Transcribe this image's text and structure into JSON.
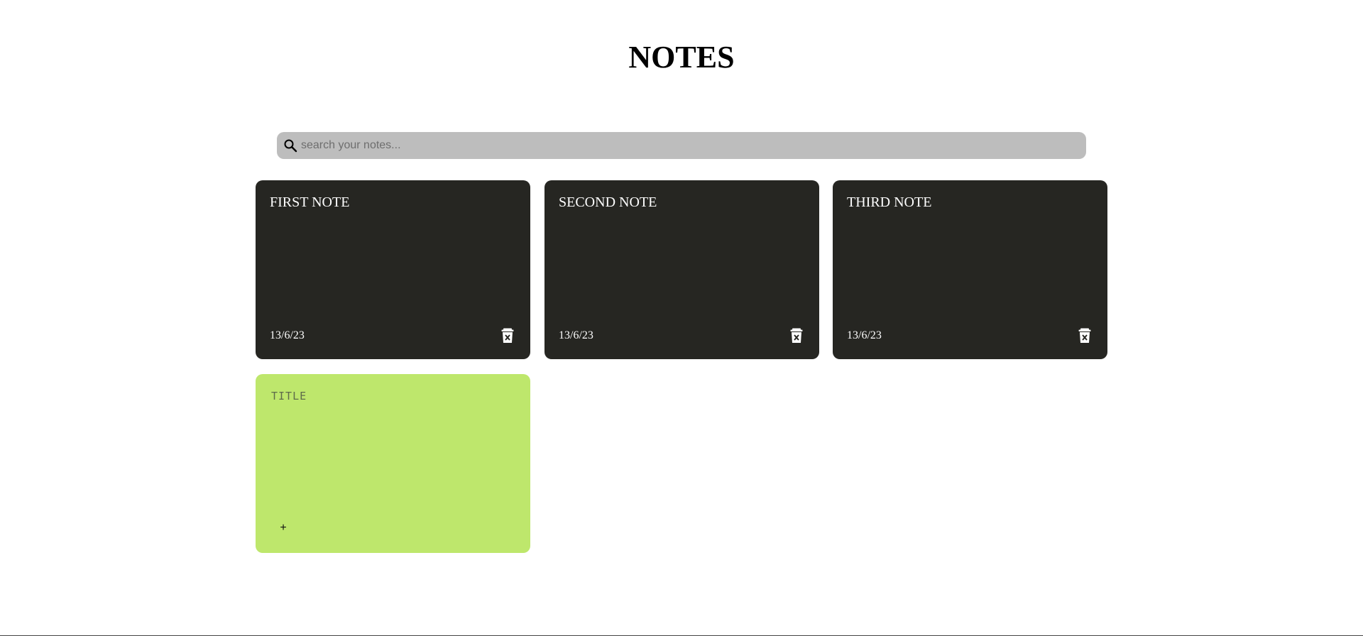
{
  "header": {
    "title": "NOTES"
  },
  "search": {
    "placeholder": "search your notes...",
    "value": "",
    "icon": "search-icon"
  },
  "notes": [
    {
      "title": "FIRST NOTE",
      "date": "13/6/23",
      "icon": "trash-x-icon"
    },
    {
      "title": "SECOND NOTE",
      "date": "13/6/23",
      "icon": "trash-x-icon"
    },
    {
      "title": "THIRD NOTE",
      "date": "13/6/23",
      "icon": "trash-x-icon"
    }
  ],
  "new_note": {
    "title_placeholder": "TITLE",
    "add_label": "+"
  },
  "colors": {
    "note_dark": "#262622",
    "note_new": "#bee76c",
    "search_bg": "#bdbdbd"
  }
}
